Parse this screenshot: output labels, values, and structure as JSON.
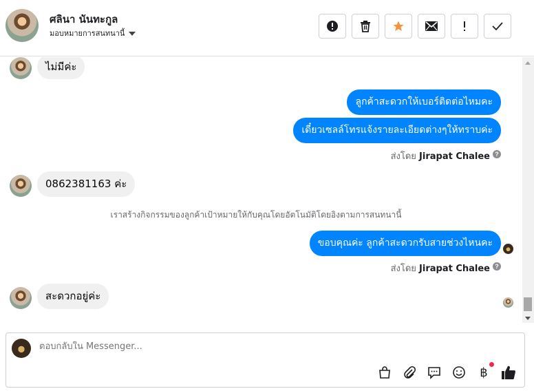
{
  "header": {
    "contact_name": "ศลินา นันทะกูล",
    "assign_label": "มอบหมายการสนทนานี้",
    "actions": [
      {
        "name": "spam-button",
        "icon": "alert-circle-icon"
      },
      {
        "name": "delete-button",
        "icon": "trash-icon"
      },
      {
        "name": "star-button",
        "icon": "star-icon",
        "color": "#f7923a"
      },
      {
        "name": "mark-unread-button",
        "icon": "envelope-icon"
      },
      {
        "name": "follow-up-button",
        "icon": "exclamation-icon"
      },
      {
        "name": "mark-done-button",
        "icon": "check-icon"
      }
    ]
  },
  "messages": {
    "m1": "ไม่มีค่ะ",
    "m2": "ลูกค้าสะดวกให้เบอร์ติดต่อไหมคะ",
    "m3": "เดี๋ยวเซลล์โทรแจ้งรายละเอียดต่างๆให้ทราบค่ะ",
    "sent_by_prefix": "ส่งโดย",
    "sent_by_name": "Jirapat Chalee",
    "m4": "0862381163 ค่ะ",
    "system_note": "เราสร้างกิจกรรมของลูกค้าเป้าหมายให้กับคุณโดยอัตโนมัติโดยอิงตามการสนทนานี้",
    "m5": "ขอบคุณค่ะ ลูกค้าสะดวกรับสายช่วงไหนคะ",
    "m6": "สะดวกอยู่ค่ะ",
    "help_glyph": "?"
  },
  "composer": {
    "placeholder": "ตอบกลับใน Messenger...",
    "tools": [
      "bag-icon",
      "paperclip-icon",
      "saved-reply-icon",
      "emoji-icon",
      "baht-payment-icon",
      "thumbs-up-icon"
    ],
    "baht_glyph": "฿"
  },
  "colors": {
    "outgoing_bubble": "#0084ff",
    "incoming_bubble": "#f0f0f0",
    "notification_dot": "#f02849"
  }
}
